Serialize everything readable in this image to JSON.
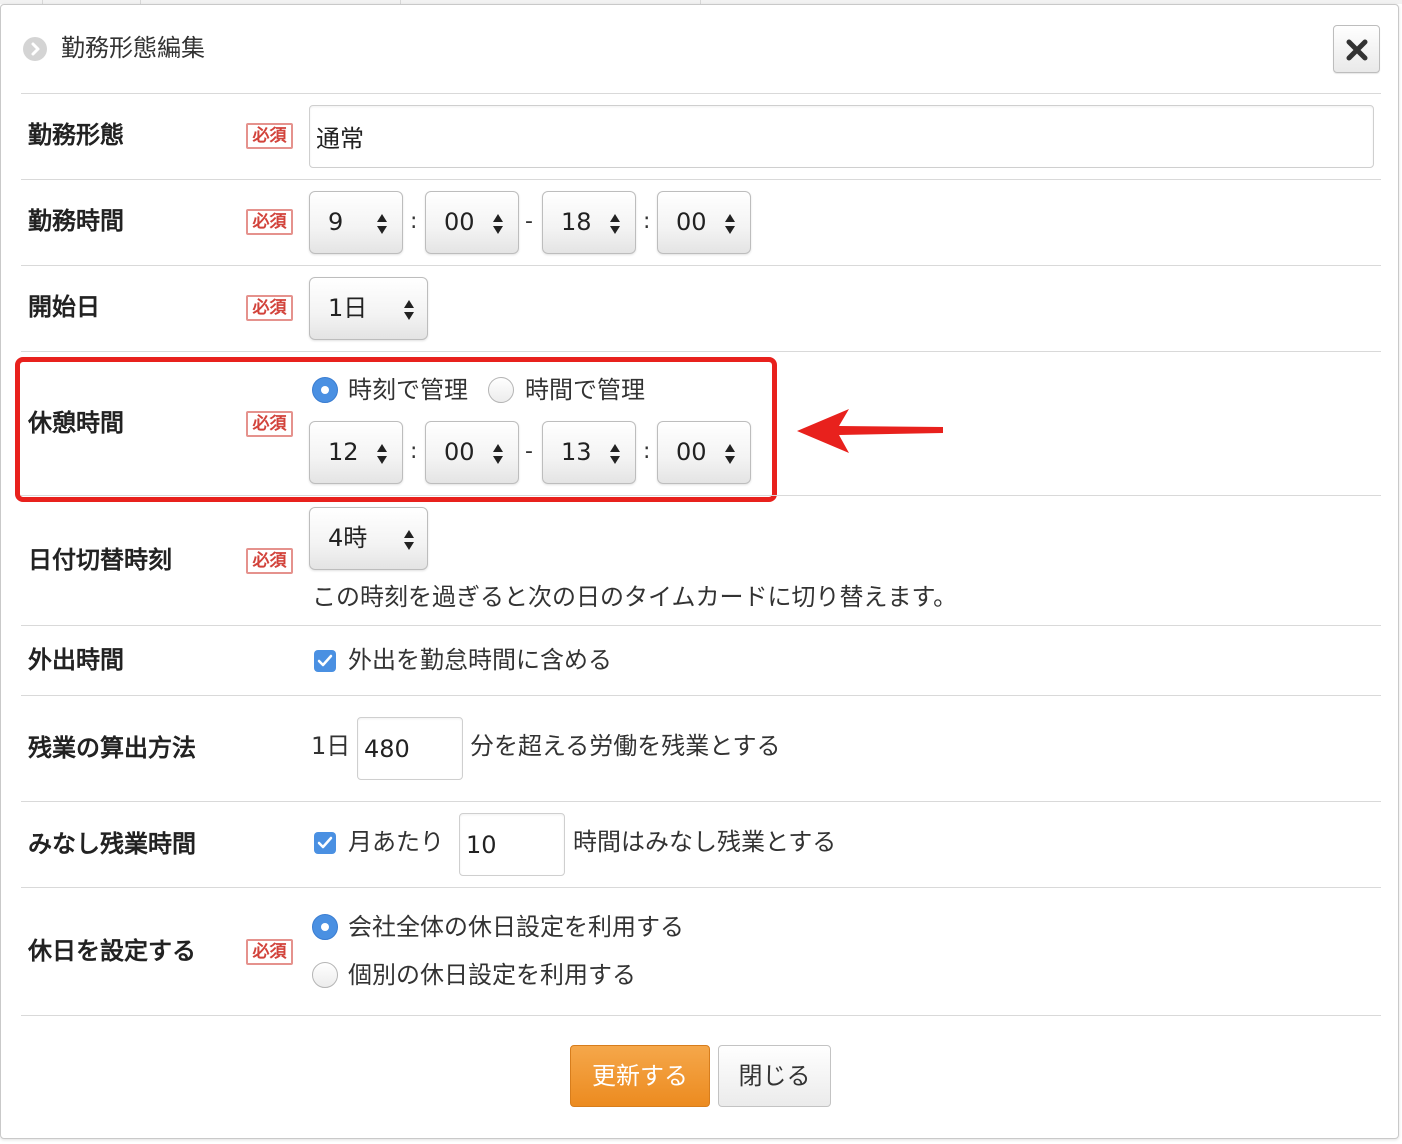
{
  "dialog": {
    "title": "勤務形態編集",
    "close_icon": "close-icon"
  },
  "required_badge": "必須",
  "fields": {
    "work_type": {
      "label": "勤務形態",
      "value": "通常"
    },
    "work_hours": {
      "label": "勤務時間",
      "start_hour": "9",
      "start_min": "00",
      "end_hour": "18",
      "end_min": "00",
      "colon": ":",
      "dash": "-"
    },
    "start_day": {
      "label": "開始日",
      "value": "1日"
    },
    "break_time": {
      "label": "休憩時間",
      "mode_options": [
        "時刻で管理",
        "時間で管理"
      ],
      "selected_mode": "時刻で管理",
      "start_hour": "12",
      "start_min": "00",
      "end_hour": "13",
      "end_min": "00"
    },
    "date_switch": {
      "label": "日付切替時刻",
      "value": "4時",
      "help": "この時刻を過ぎると次の日のタイムカードに切り替えます。"
    },
    "outing": {
      "label": "外出時間",
      "checkbox_label": "外出を勤怠時間に含める",
      "checked": true
    },
    "overtime_calc": {
      "label": "残業の算出方法",
      "prefix": "1日",
      "value": "480",
      "suffix": "分を超える労働を残業とする"
    },
    "deemed_overtime": {
      "label": "みなし残業時間",
      "checkbox_label": "月あたり",
      "checked": true,
      "value": "10",
      "suffix": "時間はみなし残業とする"
    },
    "holidays": {
      "label": "休日を設定する",
      "options": [
        "会社全体の休日設定を利用する",
        "個別の休日設定を利用する"
      ],
      "selected": "会社全体の休日設定を利用する"
    }
  },
  "buttons": {
    "update": "更新する",
    "close": "閉じる"
  },
  "colors": {
    "accent": "#4a90e2",
    "primary_button": "#ec8b20",
    "required": "#d2433b",
    "highlight": "#e8211d"
  }
}
